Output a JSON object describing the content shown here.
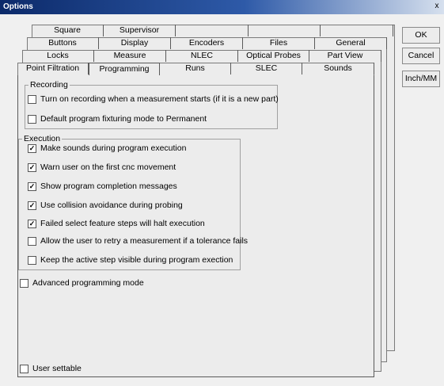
{
  "window": {
    "title": "Options",
    "close_glyph": "x"
  },
  "tabs": {
    "row1": [
      "Square",
      "Supervisor",
      "",
      "",
      ""
    ],
    "row2": [
      "Buttons",
      "Display",
      "Encoders",
      "Files",
      "General"
    ],
    "row3": [
      "Locks",
      "Measure",
      "NLEC",
      "Optical Probes",
      "Part View"
    ],
    "row4": [
      "Point Filtration",
      "Programming",
      "Runs",
      "SLEC",
      "Sounds"
    ],
    "active": "Programming"
  },
  "recording": {
    "title": "Recording",
    "items": [
      {
        "label": "Turn on recording when a measurement starts (if it is a new part)",
        "checked": false
      },
      {
        "label": "Default program fixturing mode to Permanent",
        "checked": false
      }
    ]
  },
  "execution": {
    "title": "Execution",
    "items": [
      {
        "label": "Make sounds during program execution",
        "checked": true
      },
      {
        "label": "Warn user on the first cnc movement",
        "checked": true
      },
      {
        "label": "Show program completion messages",
        "checked": true
      },
      {
        "label": "Use collision avoidance during probing",
        "checked": true
      },
      {
        "label": "Failed select feature steps will halt execution",
        "checked": true
      },
      {
        "label": "Allow the user to retry a measurement if a tolerance fails",
        "checked": false
      },
      {
        "label": "Keep the active step visible during program exection",
        "checked": false
      }
    ]
  },
  "advanced": {
    "label": "Advanced programming mode",
    "checked": false
  },
  "user_settable": {
    "label": "User settable",
    "checked": false
  },
  "buttons": {
    "ok": "OK",
    "cancel": "Cancel",
    "units": "Inch/MM"
  },
  "check_glyph": "✓"
}
